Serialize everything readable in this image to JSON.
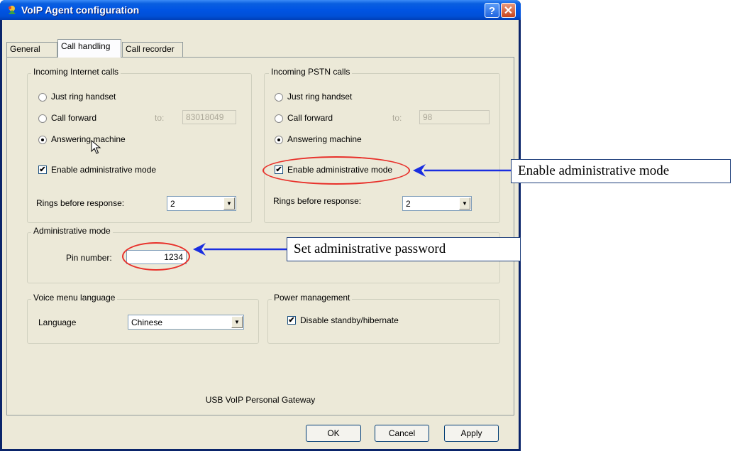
{
  "window": {
    "title": "VoIP Agent configuration",
    "help_label": "?",
    "close_label": "✕"
  },
  "tabs": [
    {
      "label": "General"
    },
    {
      "label": "Call handling",
      "selected": true
    },
    {
      "label": "Call recorder"
    }
  ],
  "incoming_internet": {
    "legend": "Incoming Internet calls",
    "options": [
      "Just ring handset",
      "Call forward",
      "Answering machine"
    ],
    "selected_index": 2,
    "forward_to_label": "to:",
    "forward_to_value": "83018049",
    "admin_mode_label": "Enable administrative mode",
    "admin_mode_checked": true,
    "rings_label": "Rings before response:",
    "rings_value": "2"
  },
  "incoming_pstn": {
    "legend": "Incoming PSTN calls",
    "options": [
      "Just ring handset",
      "Call forward",
      "Answering machine"
    ],
    "selected_index": 2,
    "forward_to_label": "to:",
    "forward_to_value": "98",
    "admin_mode_label": "Enable administrative mode",
    "admin_mode_checked": true,
    "rings_label": "Rings before response:",
    "rings_value": "2"
  },
  "admin_mode": {
    "legend": "Administrative mode",
    "pin_label": "Pin number:",
    "pin_value": "1234"
  },
  "voice_menu": {
    "legend": "Voice menu language",
    "language_label": "Language",
    "language_value": "Chinese"
  },
  "power": {
    "legend": "Power management",
    "standby_label": "Disable standby/hibernate",
    "standby_checked": true
  },
  "footer_text": "USB VoIP Personal Gateway",
  "buttons": {
    "ok": "OK",
    "cancel": "Cancel",
    "apply": "Apply"
  },
  "annotations": {
    "admin_mode_callout": "Enable administrative mode",
    "password_callout": "Set administrative password"
  },
  "colors": {
    "titlebar": "#0054e3",
    "dialog_bg": "#ece9d8",
    "annotation_ellipse": "#e8302a",
    "annotation_arrow": "#1a2ee0"
  },
  "icons": {
    "check": "✔",
    "dropdown": "▼"
  }
}
